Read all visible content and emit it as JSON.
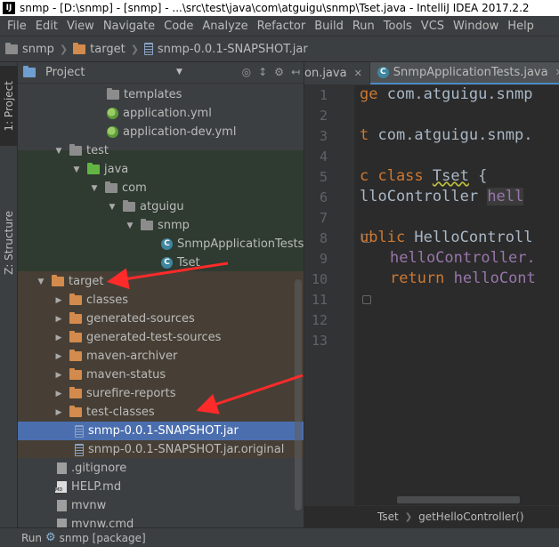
{
  "window": {
    "title": "snmp - [D:\\snmp] - [snmp] - ...\\src\\test\\java\\com\\atguigu\\snmp\\Tset.java - IntelliJ IDEA 2017.2.2",
    "app_icon_text": "IJ"
  },
  "menu": {
    "items": [
      "File",
      "Edit",
      "View",
      "Navigate",
      "Code",
      "Analyze",
      "Refactor",
      "Build",
      "Run",
      "Tools",
      "VCS",
      "Window",
      "Help"
    ]
  },
  "navbar": {
    "crumbs": [
      {
        "label": "snmp",
        "icon": "folder-gray"
      },
      {
        "label": "target",
        "icon": "folder-orange"
      },
      {
        "label": "snmp-0.0.1-SNAPSHOT.jar",
        "icon": "jar"
      }
    ]
  },
  "tool_strip": {
    "project_tab": "1: Project",
    "structure_tab": "Z: Structure"
  },
  "project_panel": {
    "title": "Project",
    "tree": [
      {
        "label": "templates",
        "icon": "folder-gray",
        "expanded": null
      },
      {
        "label": "application.yml",
        "icon": "spring-yml",
        "expanded": null
      },
      {
        "label": "application-dev.yml",
        "icon": "spring-yml",
        "expanded": null
      },
      {
        "label": "test",
        "icon": "folder-gray",
        "expanded": true
      },
      {
        "label": "java",
        "icon": "folder-green",
        "expanded": true
      },
      {
        "label": "com",
        "icon": "package",
        "expanded": true
      },
      {
        "label": "atguigu",
        "icon": "package",
        "expanded": true
      },
      {
        "label": "snmp",
        "icon": "package",
        "expanded": true
      },
      {
        "label": "SnmpApplicationTests",
        "icon": "class",
        "expanded": null
      },
      {
        "label": "Tset",
        "icon": "class",
        "expanded": null
      },
      {
        "label": "target",
        "icon": "folder-orange",
        "expanded": true
      },
      {
        "label": "classes",
        "icon": "folder-orange",
        "expanded": false
      },
      {
        "label": "generated-sources",
        "icon": "folder-orange",
        "expanded": false
      },
      {
        "label": "generated-test-sources",
        "icon": "folder-orange",
        "expanded": false
      },
      {
        "label": "maven-archiver",
        "icon": "folder-orange",
        "expanded": false
      },
      {
        "label": "maven-status",
        "icon": "folder-orange",
        "expanded": false
      },
      {
        "label": "surefire-reports",
        "icon": "folder-orange",
        "expanded": false
      },
      {
        "label": "test-classes",
        "icon": "folder-orange",
        "expanded": false
      },
      {
        "label": "snmp-0.0.1-SNAPSHOT.jar",
        "icon": "jar",
        "expanded": null,
        "selected": true
      },
      {
        "label": "snmp-0.0.1-SNAPSHOT.jar.original",
        "icon": "file",
        "expanded": null
      },
      {
        "label": ".gitignore",
        "icon": "file",
        "expanded": null
      },
      {
        "label": "HELP.md",
        "icon": "md-file",
        "expanded": null
      },
      {
        "label": "mvnw",
        "icon": "file",
        "expanded": null
      },
      {
        "label": "mvnw.cmd",
        "icon": "cmd-file",
        "expanded": null
      }
    ]
  },
  "editor": {
    "tabs": [
      {
        "label": "on.java",
        "active": false
      },
      {
        "label": "SnmpApplicationTests.java",
        "active": true
      }
    ],
    "line_numbers": [
      "1",
      "2",
      "3",
      "4",
      "5",
      "6",
      "7",
      "8",
      "9",
      "10",
      "11",
      "12",
      "13"
    ],
    "code": {
      "l1_kw": "ge",
      "l1_rest": " com.atguigu.snmp",
      "l3_kw": "t",
      "l3_rest": " com.atguigu.snmp.",
      "l5_kw1": "c class",
      "l5_cls": "Tset",
      "l5_rest": " {",
      "l6_type": "lloController",
      "l6_field": "hell",
      "l8_kw": "ublic",
      "l8_rest": " HelloControll",
      "l9_field": "helloController.",
      "l10_kw": "return",
      "l10_rest": " helloCont"
    },
    "breadcrumb": [
      "Tset",
      "getHelloController()"
    ]
  },
  "statusbar": {
    "run_label": "Run",
    "run_target": "snmp [package]"
  },
  "colors": {
    "accent": "#4b6eaf",
    "annotation_arrow": "#ff2a2a"
  }
}
